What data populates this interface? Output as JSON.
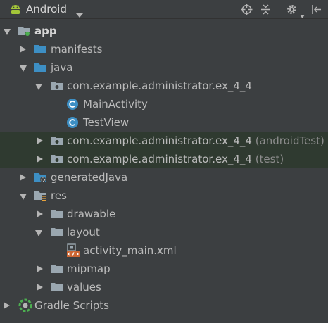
{
  "toolbar": {
    "view_label": "Android",
    "icons": [
      "android-icon",
      "dropdown-arrow-icon",
      "target-icon",
      "collapse-all-icon",
      "settings-icon",
      "hide-panel-icon"
    ]
  },
  "tree": {
    "app": "app",
    "manifests": "manifests",
    "java": "java",
    "pkg_main": "com.example.administrator.ex_4_4",
    "main_activity": "MainActivity",
    "test_view": "TestView",
    "pkg_android_test": "com.example.administrator.ex_4_4",
    "android_test_suffix": "(androidTest)",
    "pkg_test": "com.example.administrator.ex_4_4",
    "test_suffix": "(test)",
    "generated_java": "generatedJava",
    "res": "res",
    "drawable": "drawable",
    "layout": "layout",
    "activity_main": "activity_main.xml",
    "mipmap": "mipmap",
    "values": "values",
    "gradle_scripts": "Gradle Scripts"
  },
  "colors": {
    "background": "#3c3f41",
    "selected_row": "#2f3a30",
    "folder_blue": "#3d8fc4",
    "folder_gray": "#9aa7b0",
    "class_badge": "#3d8fc4",
    "android_green": "#a4c639"
  }
}
